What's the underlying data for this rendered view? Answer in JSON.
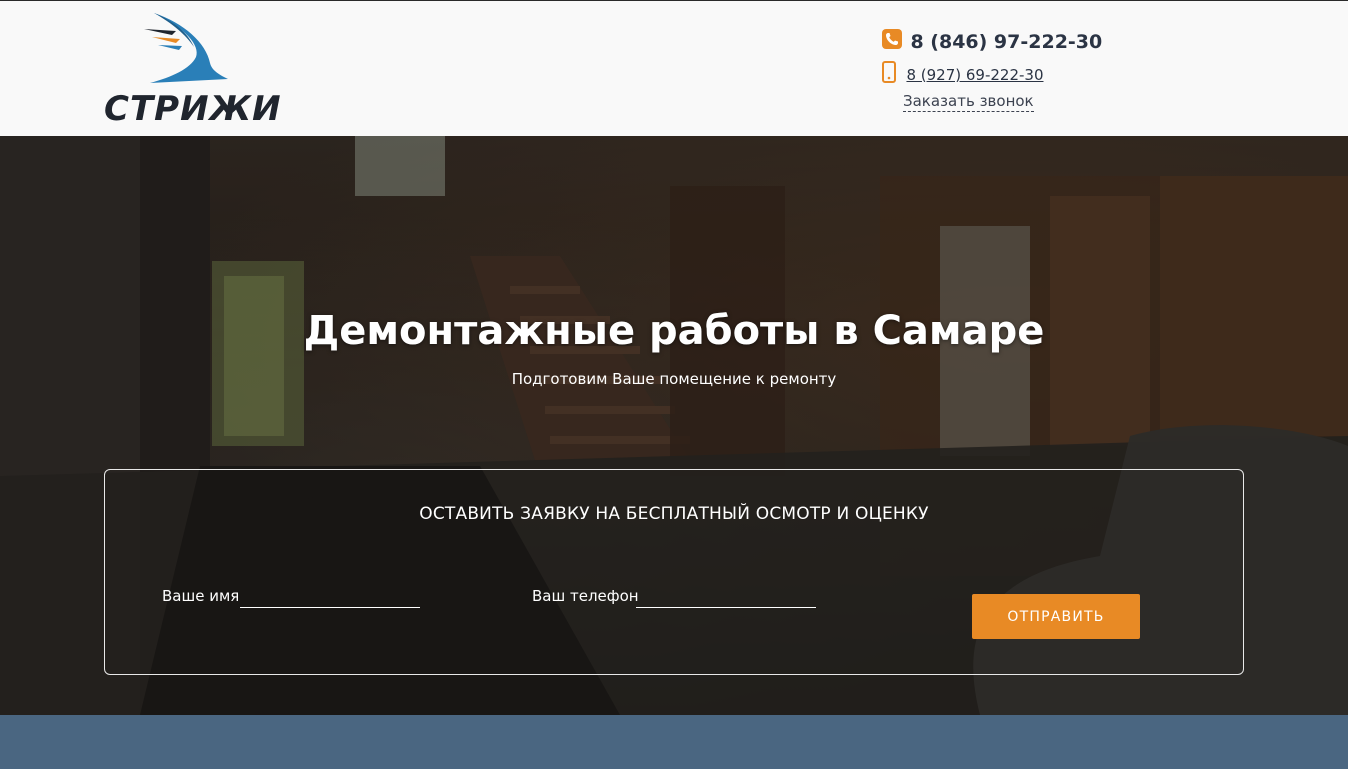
{
  "header": {
    "logo_text": "СТРИЖИ",
    "phone_main": "8 (846) 97-222-30",
    "phone_mobile": "8 (927) 69-222-30",
    "callback_label": "Заказать звонок",
    "icons": [
      "phone-icon",
      "mobile-phone-icon"
    ]
  },
  "hero": {
    "title": "Демонтажные работы в Самаре",
    "subtitle": "Подготовим Ваше помещение к ремонту"
  },
  "form": {
    "heading": "ОСТАВИТЬ ЗАЯВКУ НА БЕСПЛАТНЫЙ ОСМОТР И ОЦЕНКУ",
    "name_label": "Ваше имя",
    "name_value": "",
    "phone_label": "Ваш телефон",
    "phone_value": "",
    "submit_label": "ОТПРАВИТЬ"
  },
  "colors": {
    "accent": "#e88a25",
    "logo_blue": "#2a7fb8",
    "text_dark": "#2b3444",
    "bottom_band": "#4a6681"
  }
}
